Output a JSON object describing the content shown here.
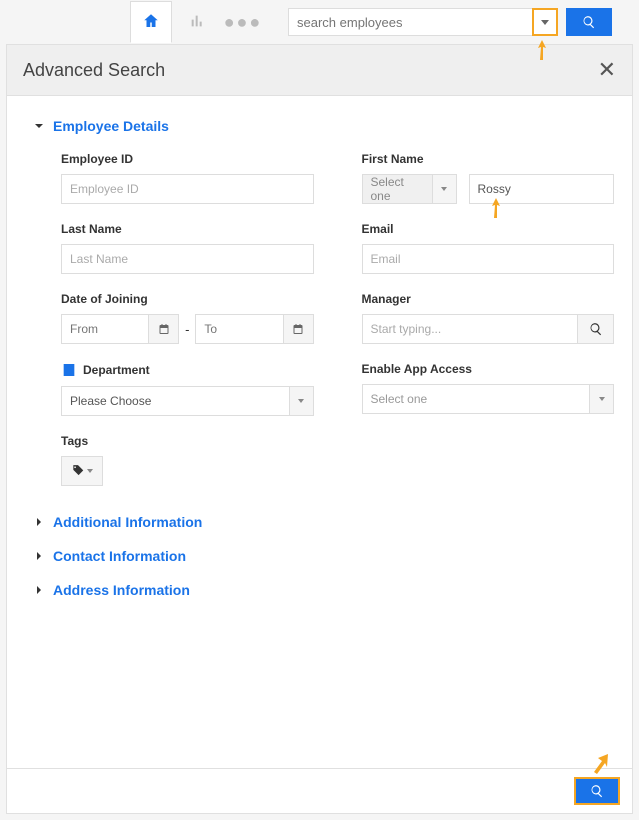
{
  "topbar": {
    "search_placeholder": "search employees"
  },
  "panel": {
    "title": "Advanced Search"
  },
  "sections": {
    "employee_details": "Employee Details",
    "additional_info": "Additional Information",
    "contact_info": "Contact Information",
    "address_info": "Address Information"
  },
  "fields": {
    "employee_id": {
      "label": "Employee ID",
      "placeholder": "Employee ID"
    },
    "first_name": {
      "label": "First Name",
      "select_placeholder": "Select one",
      "value": "Rossy"
    },
    "last_name": {
      "label": "Last Name",
      "placeholder": "Last Name"
    },
    "email": {
      "label": "Email",
      "placeholder": "Email"
    },
    "date_of_joining": {
      "label": "Date of Joining",
      "from_placeholder": "From",
      "to_placeholder": "To",
      "separator": "-"
    },
    "manager": {
      "label": "Manager",
      "placeholder": "Start typing..."
    },
    "department": {
      "label": "Department",
      "placeholder": "Please Choose"
    },
    "enable_app_access": {
      "label": "Enable App Access",
      "placeholder": "Select one"
    },
    "tags": {
      "label": "Tags"
    }
  }
}
